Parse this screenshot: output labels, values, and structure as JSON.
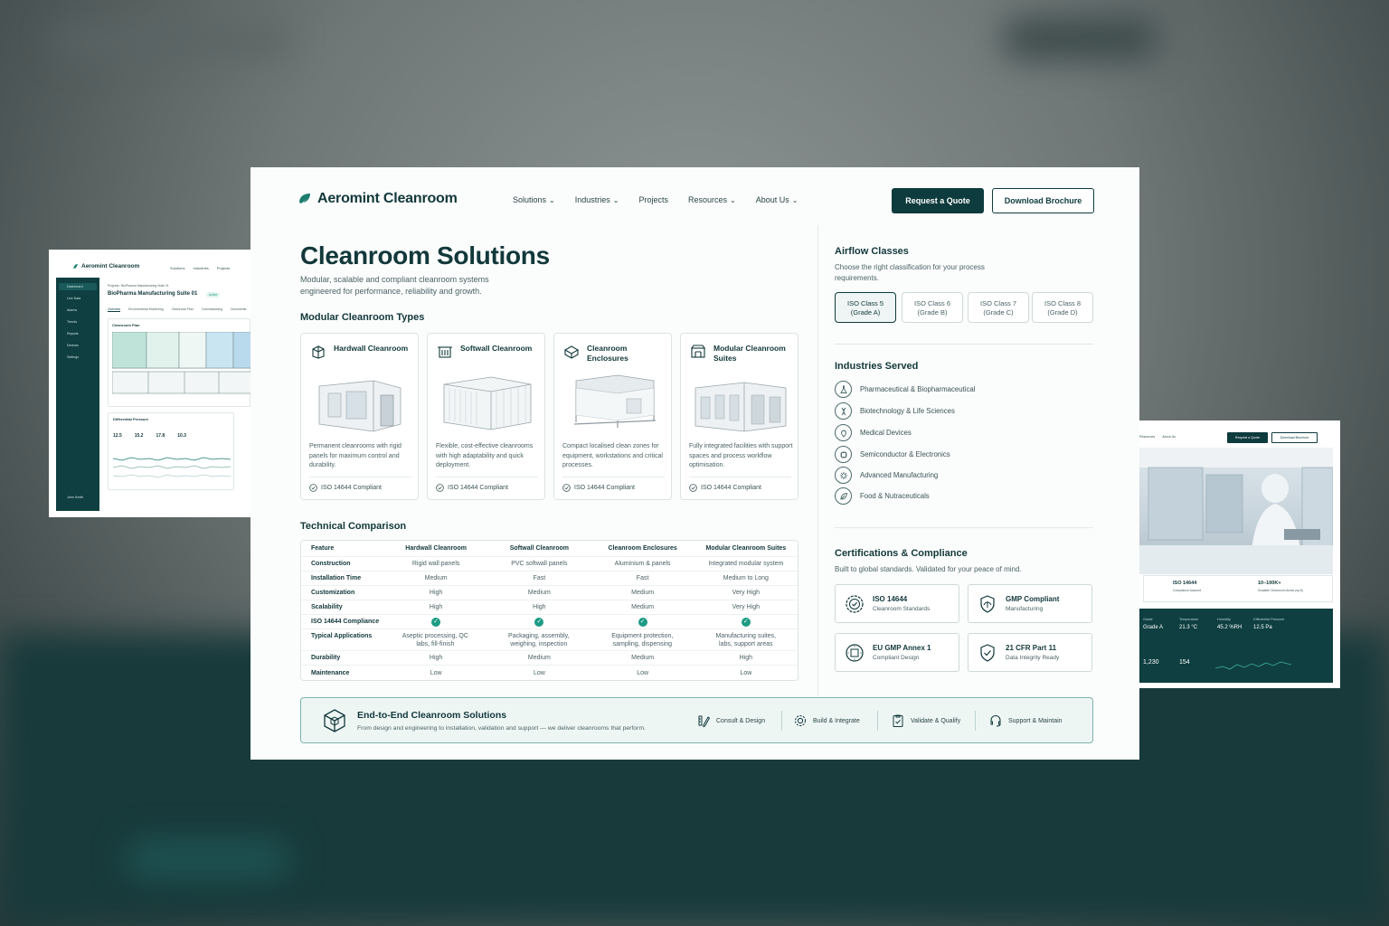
{
  "brand": {
    "name": "Aeromint Cleanroom",
    "accent": "#0e3b3d",
    "check": "#1c9b84"
  },
  "nav": {
    "items": [
      {
        "label": "Solutions",
        "dropdown": true
      },
      {
        "label": "Industries",
        "dropdown": true
      },
      {
        "label": "Projects",
        "dropdown": false
      },
      {
        "label": "Resources",
        "dropdown": true
      },
      {
        "label": "About Us",
        "dropdown": true
      }
    ],
    "quote": "Request a Quote",
    "brochure": "Download Brochure"
  },
  "hero": {
    "title": "Cleanroom Solutions",
    "subtitle": "Modular, scalable and compliant cleanroom systems engineered for performance, reliability and growth."
  },
  "types": {
    "title": "Modular Cleanroom Types",
    "cards": [
      {
        "name": "Hardwall Cleanroom",
        "icon": "hardwall-icon",
        "desc": "Permanent cleanrooms with rigid panels for maximum control and durability.",
        "cert": "ISO 14644 Compliant"
      },
      {
        "name": "Softwall Cleanroom",
        "icon": "softwall-icon",
        "desc": "Flexible, cost-effective cleanrooms with high adaptability and quick deployment.",
        "cert": "ISO 14644 Compliant"
      },
      {
        "name": "Cleanroom Enclosures",
        "icon": "enclosure-icon",
        "desc": "Compact localised clean zones for equipment, workstations and critical processes.",
        "cert": "ISO 14644 Compliant"
      },
      {
        "name": "Modular Cleanroom Suites",
        "icon": "suite-icon",
        "desc": "Fully integrated facilities with support spaces and process workflow optimisation.",
        "cert": "ISO 14644 Compliant"
      }
    ]
  },
  "comparison": {
    "title": "Technical Comparison",
    "headers": [
      "Feature",
      "Hardwall Cleanroom",
      "Softwall Cleanroom",
      "Cleanroom Enclosures",
      "Modular Cleanroom Suites"
    ],
    "rows": [
      [
        "Construction",
        "Rigid wall panels",
        "PVC softwall panels",
        "Aluminium & panels",
        "Integrated modular system"
      ],
      [
        "Installation Time",
        "Medium",
        "Fast",
        "Fast",
        "Medium to Long"
      ],
      [
        "Customization",
        "High",
        "Medium",
        "Medium",
        "Very High"
      ],
      [
        "Scalability",
        "High",
        "High",
        "Medium",
        "Very High"
      ],
      [
        "ISO 14644 Compliance",
        "check",
        "check",
        "check",
        "check"
      ],
      [
        "Typical Applications",
        "Aseptic processing, QC labs, fill-finish",
        "Packaging, assembly, weighing, inspection",
        "Equipment protection, sampling, dispensing",
        "Manufacturing suites, labs, support areas"
      ],
      [
        "Durability",
        "High",
        "Medium",
        "Medium",
        "High"
      ],
      [
        "Maintenance",
        "Low",
        "Low",
        "Low",
        "Low"
      ]
    ]
  },
  "airflow": {
    "title": "Airflow Classes",
    "subtitle": "Choose the right classification for your process requirements.",
    "classes": [
      {
        "name": "ISO Class 5",
        "grade": "(Grade A)",
        "active": true
      },
      {
        "name": "ISO Class 6",
        "grade": "(Grade B)",
        "active": false
      },
      {
        "name": "ISO Class 7",
        "grade": "(Grade C)",
        "active": false
      },
      {
        "name": "ISO Class 8",
        "grade": "(Grade D)",
        "active": false
      }
    ]
  },
  "industries": {
    "title": "Industries Served",
    "items": [
      {
        "label": "Pharmaceutical & Biopharmaceutical",
        "icon": "flask-icon"
      },
      {
        "label": "Biotechnology & Life Sciences",
        "icon": "dna-icon"
      },
      {
        "label": "Medical Devices",
        "icon": "medical-device-icon"
      },
      {
        "label": "Semiconductor & Electronics",
        "icon": "chip-icon"
      },
      {
        "label": "Advanced Manufacturing",
        "icon": "gear-icon"
      },
      {
        "label": "Food & Nutraceuticals",
        "icon": "leaf-icon"
      }
    ]
  },
  "certs": {
    "title": "Certifications & Compliance",
    "subtitle": "Built to global standards. Validated for your peace of mind.",
    "items": [
      {
        "name": "ISO 14644",
        "desc": "Cleanroom Standards",
        "icon": "iso-badge-icon"
      },
      {
        "name": "GMP Compliant",
        "desc": "Manufacturing",
        "icon": "gmp-shield-icon"
      },
      {
        "name": "EU GMP Annex 1",
        "desc": "Compliant Design",
        "icon": "eu-badge-icon"
      },
      {
        "name": "21 CFR Part 11",
        "desc": "Data Integrity Ready",
        "icon": "check-shield-icon"
      }
    ]
  },
  "e2e": {
    "title": "End-to-End Cleanroom Solutions",
    "subtitle": "From design and engineering to installation, validation and support — we deliver cleanrooms that perform.",
    "steps": [
      {
        "label": "Consult & Design",
        "icon": "pencil-ruler-icon"
      },
      {
        "label": "Build & Integrate",
        "icon": "gear-icon"
      },
      {
        "label": "Validate & Qualify",
        "icon": "clipboard-check-icon"
      },
      {
        "label": "Support & Maintain",
        "icon": "headset-icon"
      }
    ]
  },
  "left_mock": {
    "brand": "Aeromint Cleanroom",
    "nav": [
      "Solutions",
      "Industries",
      "Projects"
    ],
    "breadcrumb": "Projects  /  BioPharma Manufacturing Suite 01",
    "title": "BioPharma Manufacturing Suite 01",
    "status": "Active",
    "tabs": [
      "Overview",
      "Environmental Monitoring",
      "Cleanroom Plan",
      "Commissioning",
      "Documents"
    ],
    "sidebar": [
      "Dashboard",
      "Live Data",
      "Alarms",
      "Trends",
      "Reports",
      "Devices",
      "Settings"
    ],
    "plan_title": "Cleanroom Plan",
    "pressure_title": "Differential Pressure",
    "readings": [
      {
        "room": "Grade A",
        "value": "12.5",
        "unit": "Pa"
      },
      {
        "room": "Grade B",
        "value": "15.2",
        "unit": "Pa"
      },
      {
        "room": "Grade C",
        "value": "17.8",
        "unit": "Pa"
      },
      {
        "room": "Grade D",
        "value": "10.3",
        "unit": "Pa"
      }
    ],
    "user": "John Smith"
  },
  "right_mock": {
    "nav": [
      "Resources",
      "About Us"
    ],
    "quote": "Request a Quote",
    "brochure": "Download Brochure",
    "stats": [
      {
        "value": "ISO 14644",
        "label": "Compliance Assured"
      },
      {
        "value": "10–100K+",
        "label": "Scalable Cleanroom Areas (sq ft)"
      }
    ],
    "dash": [
      {
        "label": "Grade",
        "value": "Grade A"
      },
      {
        "label": "Temperature",
        "value": "21.3 °C"
      },
      {
        "label": "Humidity",
        "value": "45.2 %RH"
      },
      {
        "label": "Differential Pressure",
        "value": "12.5 Pa"
      }
    ],
    "counts": [
      "1,230",
      "154"
    ]
  }
}
